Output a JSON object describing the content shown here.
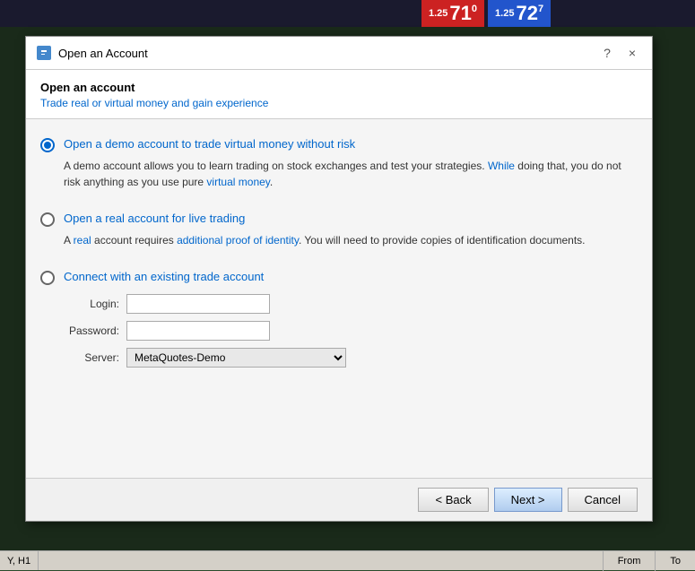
{
  "topbar": {
    "price_red_small": "1.25",
    "price_red_big": "71",
    "price_red_super": "0",
    "price_blue_small": "1.25",
    "price_blue_big": "72",
    "price_blue_super": "7"
  },
  "dialog": {
    "title": "Open an Account",
    "help_label": "?",
    "close_label": "×",
    "header_title": "Open an account",
    "header_subtitle": "Trade real or virtual money and gain experience"
  },
  "options": {
    "demo_label": "Open a demo account to trade virtual money without risk",
    "demo_desc_part1": "A demo account allows you to learn trading on stock exchanges and test your strategies.",
    "demo_desc_highlight": " While",
    "demo_desc_part2": " doing that, you do not risk anything as you use pure",
    "demo_desc_highlight2": " virtual money",
    "demo_desc_part3": ".",
    "real_label": "Open a real account for live trading",
    "real_desc_part1": "A",
    "real_desc_highlight1": " real",
    "real_desc_part2": " account requires",
    "real_desc_highlight2": " additional proof of identity",
    "real_desc_part3": ". You will need to provide copies of identification documents.",
    "connect_label": "Connect with an existing trade account",
    "login_label": "Login:",
    "password_label": "Password:",
    "server_label": "Server:",
    "server_value": "MetaQuotes-Demo"
  },
  "buttons": {
    "back_label": "< Back",
    "next_label": "Next >",
    "cancel_label": "Cancel"
  },
  "statusbar": {
    "left_label": "Y, H1",
    "from_label": "From",
    "to_label": "To"
  }
}
